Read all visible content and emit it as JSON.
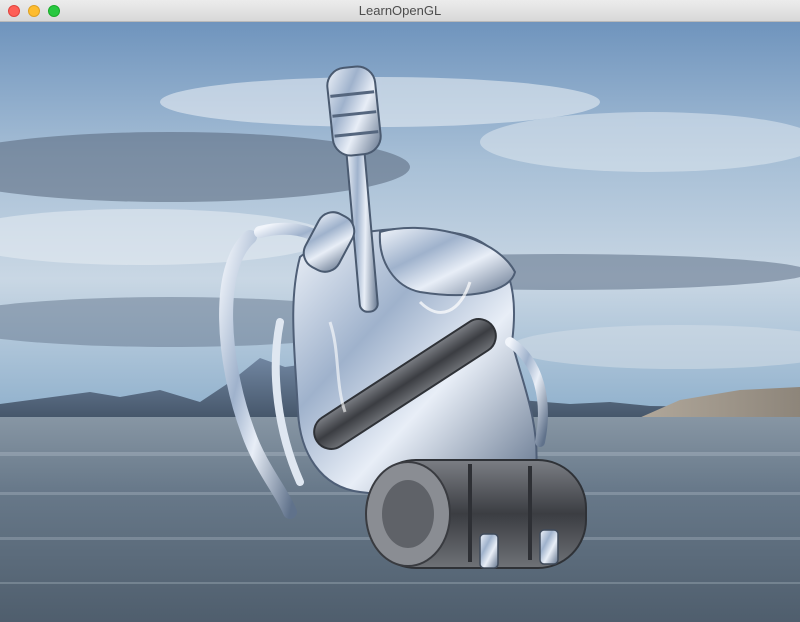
{
  "window": {
    "title": "LearnOpenGL"
  },
  "traffic_lights": {
    "close": "close-button",
    "minimize": "minimize-button",
    "zoom": "zoom-button"
  },
  "scene": {
    "description_icon": "backpack-3d-model",
    "sky_color": "#7fa3c6",
    "water_color": "#5d6d7c",
    "model_color": "#c9d3e2"
  }
}
